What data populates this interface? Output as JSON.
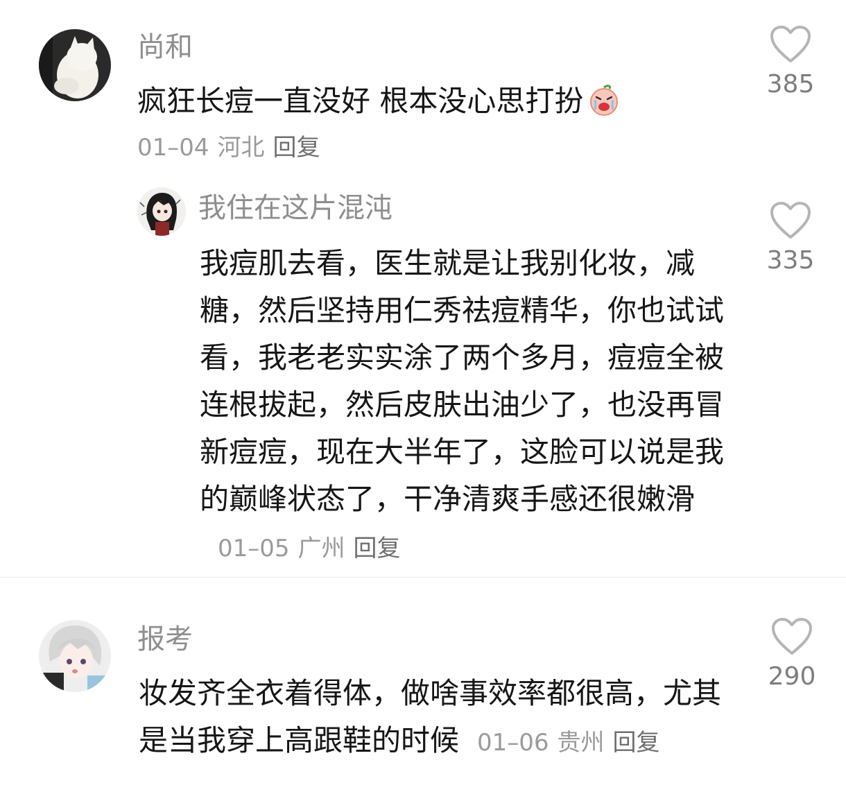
{
  "comments": [
    {
      "username": "尚和",
      "text": "疯狂长痘一直没好 根本没心思打扮",
      "emoji_icon": "crying-peach-emoji",
      "date": "01–04",
      "location": "河北",
      "reply_label": "回复",
      "likes": "385"
    },
    {
      "username": "我住在这片混沌",
      "text": "我痘肌去看，医生就是让我别化妆，减糖，然后坚持用仁秀祛痘精华，你也试试看，我老老实实涂了两个多月，痘痘全被连根拔起，然后皮肤出油少了，也没再冒新痘痘，现在大半年了，这脸可以说是我的巅峰状态了，干净清爽手感还很嫩滑",
      "date": "01–05",
      "location": "广州",
      "reply_label": "回复",
      "likes": "335"
    },
    {
      "username": "报考",
      "text": "妆发齐全衣着得体，做啥事效率都很高，尤其是当我穿上高跟鞋的时候",
      "date": "01–06",
      "location": "贵州",
      "reply_label": "回复",
      "likes": "290"
    }
  ],
  "icons": {
    "like": "heart-outline-icon"
  },
  "colors": {
    "username": "#8e8e8e",
    "text": "#161616",
    "meta": "#9a9a9a",
    "reply": "#6e6e6e",
    "heart": "#b5b5b5"
  }
}
